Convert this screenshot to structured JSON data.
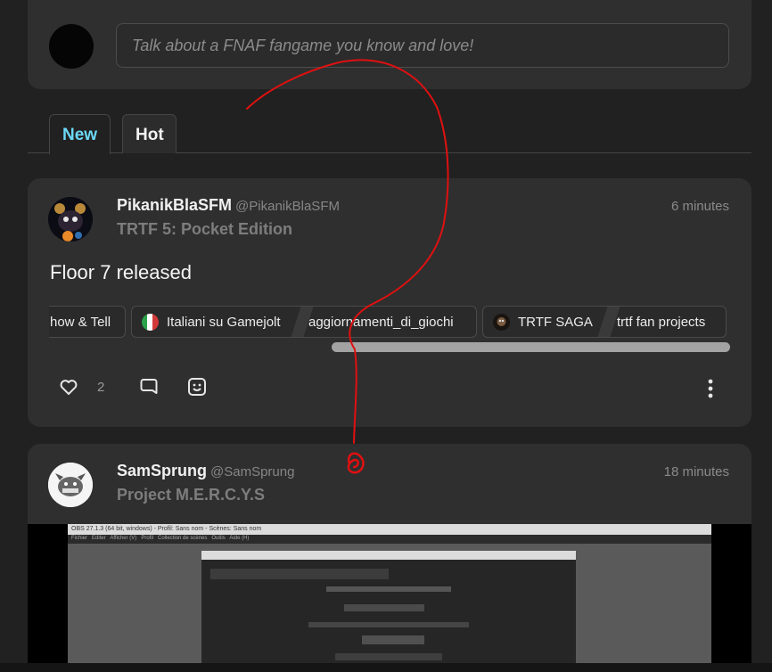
{
  "composer": {
    "placeholder": "Talk about a FNAF fangame you know and love!"
  },
  "tabs": [
    {
      "label": "New",
      "active": true
    },
    {
      "label": "Hot",
      "active": false
    }
  ],
  "posts": [
    {
      "author": "PikanikBlaSFM",
      "handle": "@PikanikBlaSFM",
      "game": "TRTF 5: Pocket Edition",
      "time": "6 minutes",
      "text": "Floor 7 released",
      "communities": [
        {
          "segments": [
            "how & Tell"
          ]
        },
        {
          "icon": "italy-flag-icon",
          "segments": [
            "Italiani su Gamejolt",
            "aggiornamenti_di_giochi"
          ]
        },
        {
          "icon": "trtf-saga-icon",
          "segments": [
            "TRTF SAGA",
            "trtf fan projects"
          ]
        }
      ],
      "likes": "2"
    },
    {
      "author": "SamSprung",
      "handle": "@SamSprung",
      "game": "Project M.E.R.C.Y.S",
      "time": "18 minutes",
      "screenshot": {
        "title": "OBS 27.1.3 (64 bit, windows) - Profil: Sans nom - Scènes: Sans nom",
        "menu": [
          "Fichier",
          "Editer",
          "Afficher (V)",
          "Profil",
          "Collection de scènes",
          "Outils",
          "Aide (H)"
        ]
      }
    }
  ],
  "colors": {
    "accent": "#6bd9f5",
    "background": "#212121",
    "card": "#2f2f2f",
    "annotation": "#e01010"
  }
}
